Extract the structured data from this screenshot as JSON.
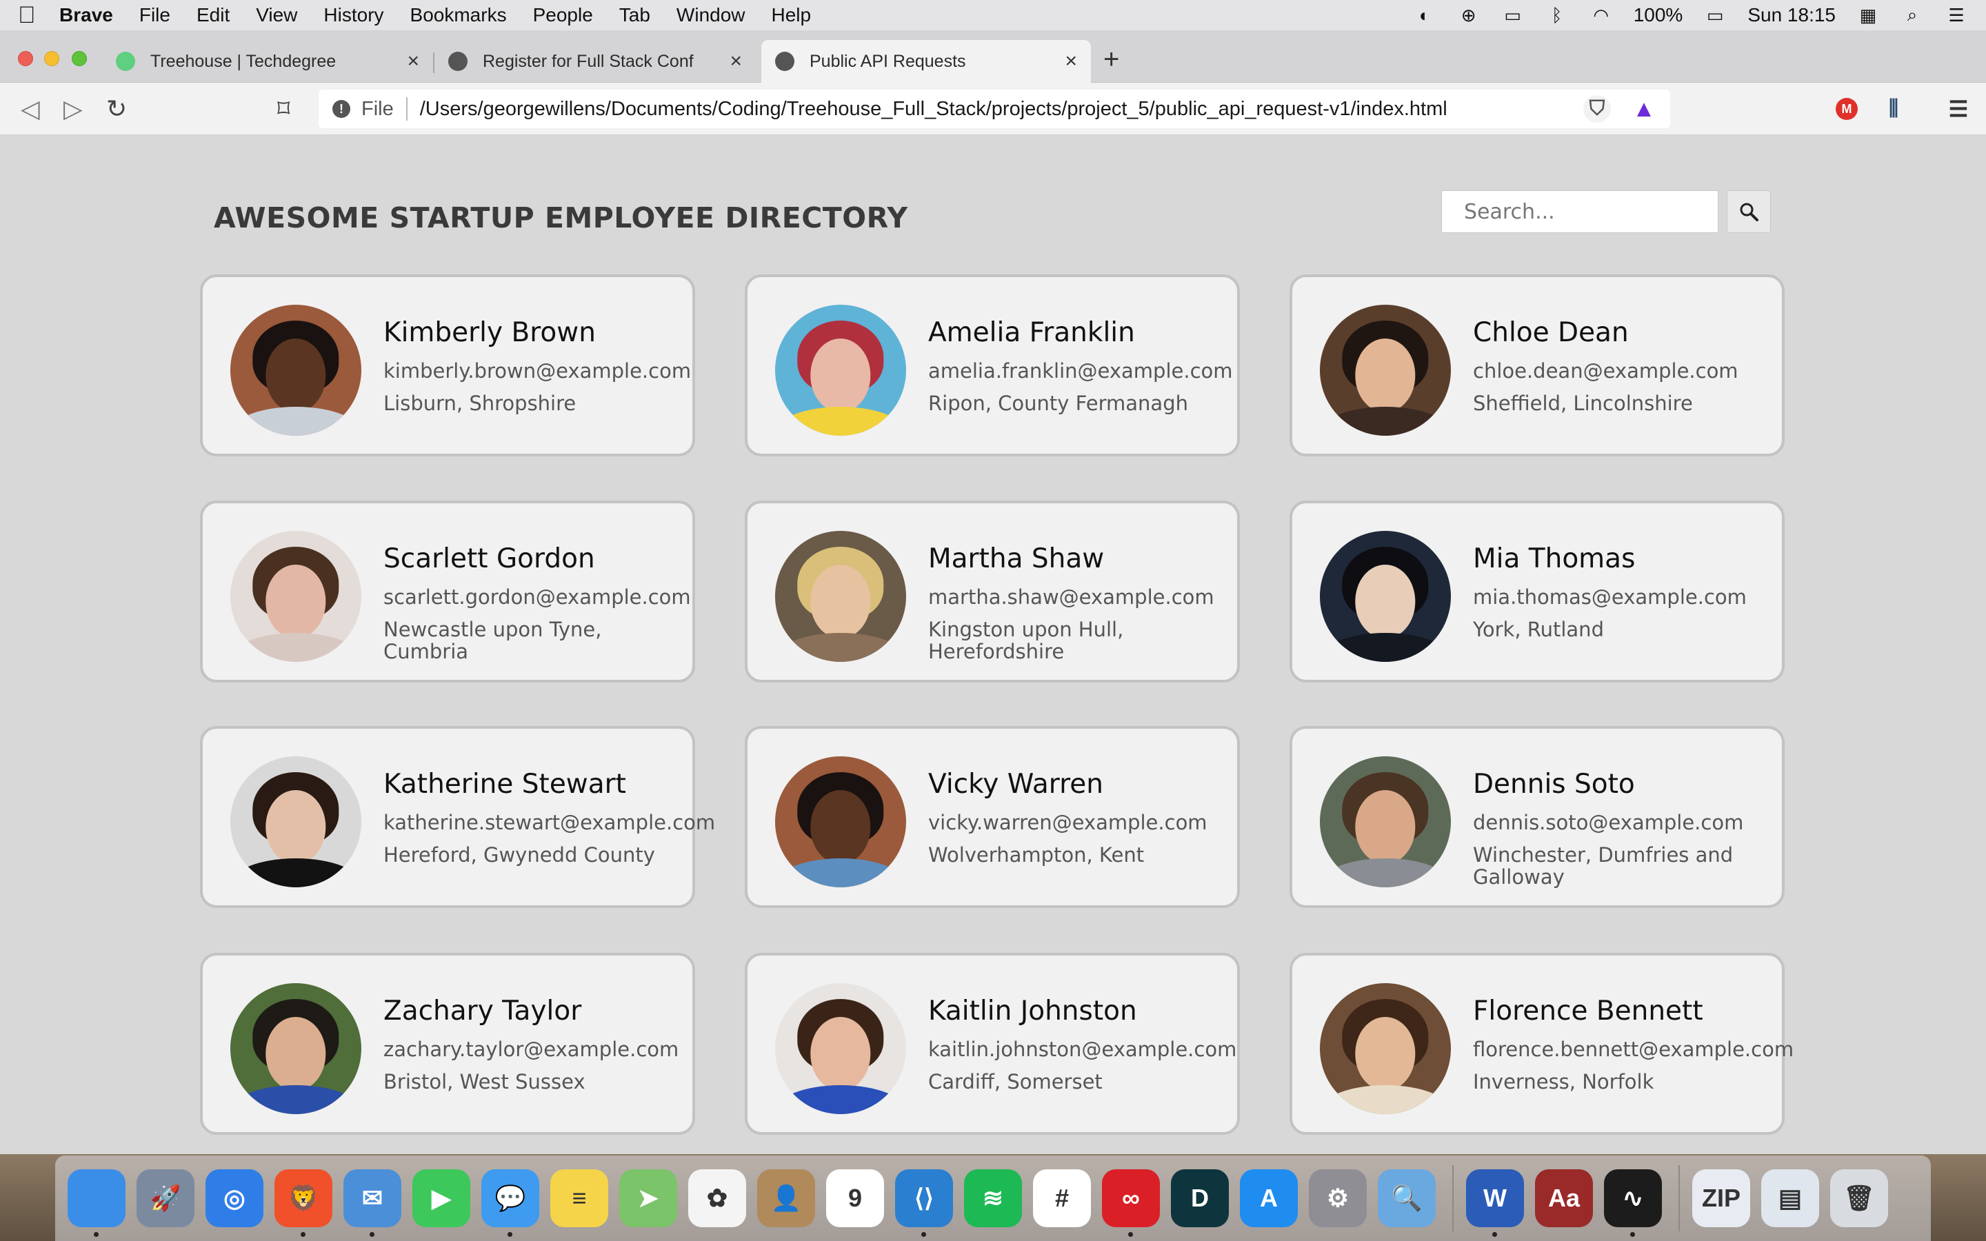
{
  "menubar": {
    "app_name": "Brave",
    "items": [
      "File",
      "Edit",
      "View",
      "History",
      "Bookmarks",
      "People",
      "Tab",
      "Window",
      "Help"
    ],
    "battery": "100%",
    "clock": "Sun 18:15"
  },
  "tabs": [
    {
      "title": "Treehouse | Techdegree",
      "favicon_color": "#5fcf80"
    },
    {
      "title": "Register for Full Stack Conf",
      "favicon_color": "#555555"
    },
    {
      "title": "Public API Requests",
      "favicon_color": "#555555"
    }
  ],
  "address_bar": {
    "scheme": "File",
    "url": "/Users/georgewillens/Documents/Coding/Treehouse_Full_Stack/projects/project_5/public_api_request-v1/index.html"
  },
  "page": {
    "title": "AWESOME STARTUP EMPLOYEE DIRECTORY",
    "search_placeholder": "Search..."
  },
  "employees": [
    {
      "name": "Kimberly Brown",
      "email": "kimberly.brown@example.com",
      "location": "Lisburn, Shropshire",
      "bg": "#9b5a3c",
      "skin": "#5a3522",
      "hair": "#1a1210",
      "shirt": "#c9cfd6"
    },
    {
      "name": "Amelia Franklin",
      "email": "amelia.franklin@example.com",
      "location": "Ripon, County Fermanagh",
      "bg": "#5fb3d6",
      "skin": "#e8b9a6",
      "hair": "#b0303e",
      "shirt": "#f2d23a"
    },
    {
      "name": "Chloe Dean",
      "email": "chloe.dean@example.com",
      "location": "Sheffield, Lincolnshire",
      "bg": "#5a3e2c",
      "skin": "#e2b595",
      "hair": "#1f1612",
      "shirt": "#3b2a22"
    },
    {
      "name": "Scarlett Gordon",
      "email": "scarlett.gordon@example.com",
      "location": "Newcastle upon Tyne, Cumbria",
      "bg": "#e4dcd8",
      "skin": "#e3b7a6",
      "hair": "#4a3020",
      "shirt": "#d8c8c2"
    },
    {
      "name": "Martha Shaw",
      "email": "martha.shaw@example.com",
      "location": "Kingston upon Hull, Herefordshire",
      "bg": "#6a5a48",
      "skin": "#e6c2a0",
      "hair": "#d9bf7a",
      "shirt": "#8a7058"
    },
    {
      "name": "Mia Thomas",
      "email": "mia.thomas@example.com",
      "location": "York, Rutland",
      "bg": "#1f2838",
      "skin": "#e8cdb8",
      "hair": "#0d0d12",
      "shirt": "#141820"
    },
    {
      "name": "Katherine Stewart",
      "email": "katherine.stewart@example.com",
      "location": "Hereford, Gwynedd County",
      "bg": "#d8d8d8",
      "skin": "#e4bfa8",
      "hair": "#2a1a14",
      "shirt": "#121212"
    },
    {
      "name": "Vicky Warren",
      "email": "vicky.warren@example.com",
      "location": "Wolverhampton, Kent",
      "bg": "#9b5a3c",
      "skin": "#5a3522",
      "hair": "#1a1210",
      "shirt": "#5c8fbf"
    },
    {
      "name": "Dennis Soto",
      "email": "dennis.soto@example.com",
      "location": "Winchester, Dumfries and Galloway",
      "bg": "#5e6a58",
      "skin": "#d8a888",
      "hair": "#4a3424",
      "shirt": "#8a8e94"
    },
    {
      "name": "Zachary Taylor",
      "email": "zachary.taylor@example.com",
      "location": "Bristol, West Sussex",
      "bg": "#4f6e3a",
      "skin": "#dcae90",
      "hair": "#1e1a16",
      "shirt": "#2b4fa8"
    },
    {
      "name": "Kaitlin Johnston",
      "email": "kaitlin.johnston@example.com",
      "location": "Cardiff, Somerset",
      "bg": "#e8e4e2",
      "skin": "#e6b89e",
      "hair": "#3a2418",
      "shirt": "#2a4fb8"
    },
    {
      "name": "Florence Bennett",
      "email": "florence.bennett@example.com",
      "location": "Inverness, Norfolk",
      "bg": "#6e4e36",
      "skin": "#e2b896",
      "hair": "#3e2618",
      "shirt": "#e8dcc8"
    }
  ],
  "dock": [
    {
      "name": "finder-icon",
      "color": "#3b8ee8",
      "glyph": ""
    },
    {
      "name": "launchpad-icon",
      "color": "#7c8aa0",
      "glyph": "🚀"
    },
    {
      "name": "safari-icon",
      "color": "#2f7ee8",
      "glyph": "◎"
    },
    {
      "name": "brave-icon",
      "color": "#f0512a",
      "glyph": "🦁"
    },
    {
      "name": "mail-icon",
      "color": "#4b8fd8",
      "glyph": "✉"
    },
    {
      "name": "facetime-icon",
      "color": "#3cc85a",
      "glyph": "▶"
    },
    {
      "name": "messages-icon",
      "color": "#3e9bf0",
      "glyph": "💬"
    },
    {
      "name": "notes-icon",
      "color": "#f5d44a",
      "glyph": "≡"
    },
    {
      "name": "maps-icon",
      "color": "#7cc46a",
      "glyph": "➤"
    },
    {
      "name": "photos-icon",
      "color": "#f4f4f4",
      "glyph": "✿"
    },
    {
      "name": "contacts-icon",
      "color": "#b08a5a",
      "glyph": "👤"
    },
    {
      "name": "calendar-icon",
      "color": "#ffffff",
      "glyph": "9"
    },
    {
      "name": "vscode-icon",
      "color": "#2b7fd0",
      "glyph": "⟨⟩"
    },
    {
      "name": "spotify-icon",
      "color": "#1db954",
      "glyph": "≋"
    },
    {
      "name": "slack-icon",
      "color": "#ffffff",
      "glyph": "#"
    },
    {
      "name": "creative-cloud-icon",
      "color": "#da1f26",
      "glyph": "∞"
    },
    {
      "name": "dashlane-icon",
      "color": "#0e353d",
      "glyph": "D"
    },
    {
      "name": "app-store-icon",
      "color": "#1f8cf0",
      "glyph": "A"
    },
    {
      "name": "system-preferences-icon",
      "color": "#8e8e94",
      "glyph": "⚙"
    },
    {
      "name": "preview-icon",
      "color": "#6aa8e0",
      "glyph": "🔍"
    },
    {
      "name": "word-icon",
      "color": "#2b5cb8",
      "glyph": "W"
    },
    {
      "name": "dictionary-icon",
      "color": "#9a2a2a",
      "glyph": "Aa"
    },
    {
      "name": "activity-monitor-icon",
      "color": "#1c1c1c",
      "glyph": "∿"
    },
    {
      "name": "archive-icon",
      "color": "#e8ecf2",
      "glyph": "ZIP"
    },
    {
      "name": "downloads-icon",
      "color": "#dfe6ee",
      "glyph": "▤"
    },
    {
      "name": "trash-icon",
      "color": "#d8dce0",
      "glyph": "🗑"
    }
  ]
}
